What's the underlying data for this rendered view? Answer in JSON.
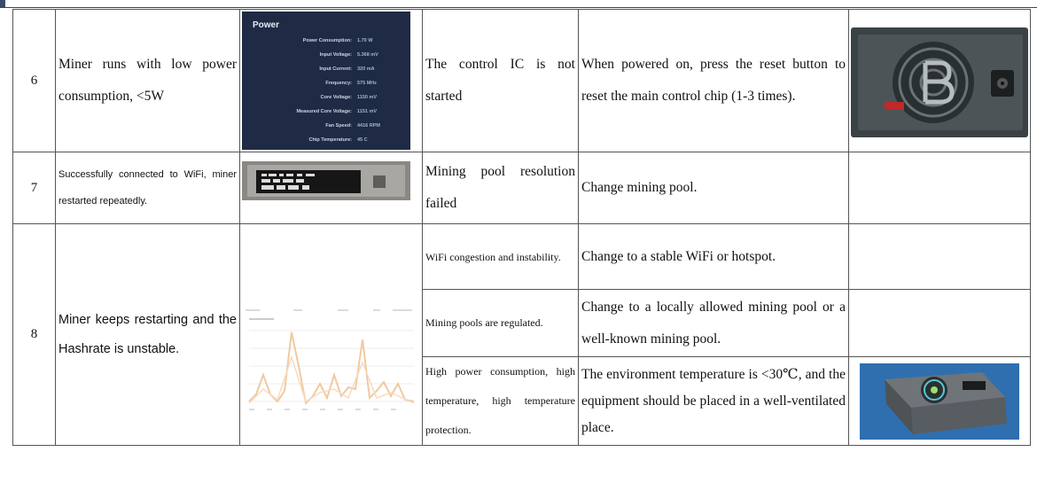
{
  "table": {
    "rows": [
      {
        "num": "6",
        "symptom": "Miner runs with low power consumption, <5W",
        "cause": "The control IC is not started",
        "solution": "When powered on, press the reset button to reset the main control chip (1-3 times).",
        "power_panel": {
          "title": "Power",
          "labels": [
            "Power Consumption:",
            "Input Voltage:",
            "Input Current:",
            "Frequency:",
            "Core Voltage:",
            "Measured Core Voltage:",
            "Fan Speed:",
            "Chip Temperature:"
          ],
          "values": [
            "1.70 W",
            "5.368 mV",
            "320 mA",
            "575 MHz",
            "1150 mV",
            "1151 mV",
            "4416 RPM",
            "45 C"
          ]
        }
      },
      {
        "num": "7",
        "symptom": "Successfully connected to WiFi, miner restarted repeatedly.",
        "cause": "Mining pool resolution failed",
        "solution": "Change mining pool."
      },
      {
        "num": "8",
        "symptom": "Miner keeps restarting and the Hashrate is unstable.",
        "subrows": [
          {
            "cause": "WiFi congestion and instability.",
            "solution": "Change to a stable WiFi or hotspot."
          },
          {
            "cause": "Mining pools are regulated.",
            "solution": "Change to a locally allowed mining pool or a well-known mining pool."
          },
          {
            "cause": "High power consumption, high temperature, high temperature protection.",
            "solution": "The environment temperature is <30℃, and the equipment should be placed in a well-ventilated place."
          }
        ]
      }
    ]
  },
  "colors": {
    "panel_bg": "#1f2b44",
    "device_red": "#c0282a",
    "device_blue": "#2f6fb0"
  }
}
